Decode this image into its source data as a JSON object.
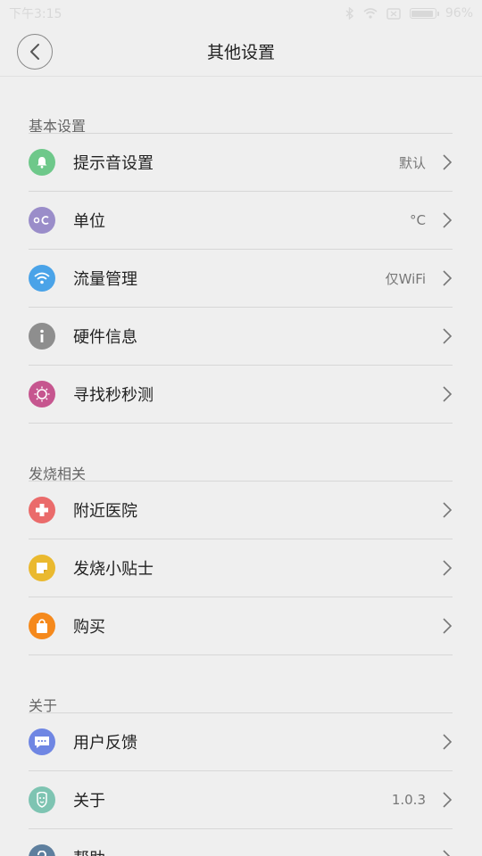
{
  "status_bar": {
    "time": "下午3:15",
    "battery": "96%",
    "battery_level": 0.96,
    "icons": [
      "bluetooth-icon",
      "wifi-icon",
      "sim-icon",
      "battery-icon"
    ]
  },
  "header": {
    "title": "其他设置",
    "back_icon": "back-arrow-icon"
  },
  "sections": [
    {
      "title": "基本设置",
      "items": [
        {
          "label": "提示音设置",
          "value": "默认",
          "icon": "bell-icon",
          "color": "#6ec88a"
        },
        {
          "label": "单位",
          "value": "°C",
          "icon": "celsius-icon",
          "color": "#9a8dc9"
        },
        {
          "label": "流量管理",
          "value": "仅WiFi",
          "icon": "wifi-icon",
          "color": "#4aa3e8"
        },
        {
          "label": "硬件信息",
          "value": "",
          "icon": "info-icon",
          "color": "#8e8e8e"
        },
        {
          "label": "寻找秒秒测",
          "value": "",
          "icon": "sun-icon",
          "color": "#c6568f"
        }
      ]
    },
    {
      "title": "发烧相关",
      "items": [
        {
          "label": "附近医院",
          "value": "",
          "icon": "hospital-cross-icon",
          "color": "#ea6b6b"
        },
        {
          "label": "发烧小贴士",
          "value": "",
          "icon": "sticky-note-icon",
          "color": "#eab92f"
        },
        {
          "label": "购买",
          "value": "",
          "icon": "shopping-bag-icon",
          "color": "#f5891c"
        }
      ]
    },
    {
      "title": "关于",
      "items": [
        {
          "label": "用户反馈",
          "value": "",
          "icon": "feedback-icon",
          "color": "#6f86e3"
        },
        {
          "label": "关于",
          "value": "1.0.3",
          "icon": "about-icon",
          "color": "#7ec4b2"
        },
        {
          "label": "帮助",
          "value": "",
          "icon": "help-icon",
          "color": "#5e7f9e"
        }
      ]
    }
  ],
  "colors": {
    "background": "#efefef",
    "divider": "#d7d7d7"
  }
}
